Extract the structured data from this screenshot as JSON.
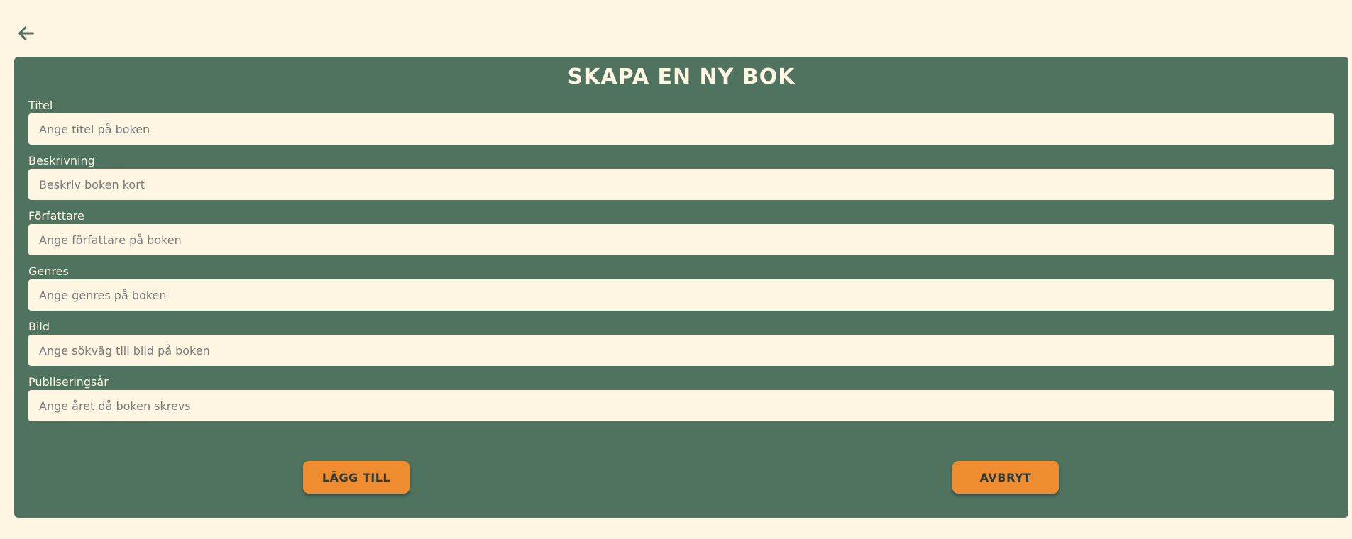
{
  "nav": {
    "back_icon": "arrow-left-icon",
    "icon_color": "#4f735f"
  },
  "form": {
    "title": "SKAPA EN NY BOK",
    "fields": [
      {
        "label": "Titel",
        "placeholder": "Ange titel på boken",
        "value": ""
      },
      {
        "label": "Beskrivning",
        "placeholder": "Beskriv boken kort",
        "value": ""
      },
      {
        "label": "Författare",
        "placeholder": "Ange författare på boken",
        "value": ""
      },
      {
        "label": "Genres",
        "placeholder": "Ange genres på boken",
        "value": ""
      },
      {
        "label": "Bild",
        "placeholder": "Ange sökväg till bild på boken",
        "value": ""
      },
      {
        "label": "Publiseringsår",
        "placeholder": "Ange året då boken skrevs",
        "value": ""
      }
    ],
    "add_label": "LÄGG TILL",
    "cancel_label": "AVBRYT"
  },
  "colors": {
    "background": "#fff6e3",
    "panel": "#4f735f",
    "accent": "#ee8c2f",
    "text_light": "#fff6e3",
    "text_dark": "#2f3a33"
  }
}
